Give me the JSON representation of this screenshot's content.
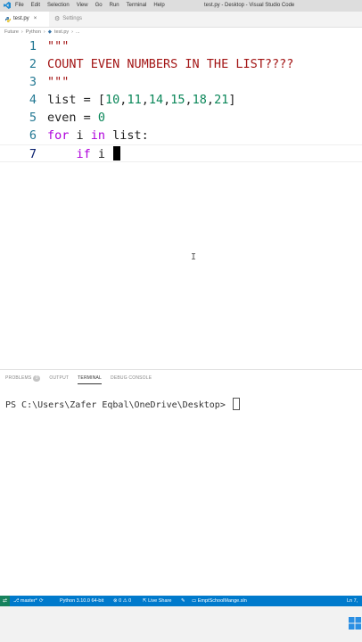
{
  "titlebar": {
    "menu": [
      "File",
      "Edit",
      "Selection",
      "View",
      "Go",
      "Run",
      "Terminal",
      "Help"
    ],
    "window_title": "test.py - Desktop - Visual Studio Code"
  },
  "tabs": [
    {
      "label": "test.py",
      "icon": "python-file-icon",
      "active": true
    },
    {
      "label": "Settings",
      "icon": "gear-icon",
      "active": false
    }
  ],
  "breadcrumb": [
    "Future",
    "Python",
    "test.py",
    "..."
  ],
  "editor": {
    "lines": [
      {
        "number": "1",
        "text": "\"\"\""
      },
      {
        "number": "2",
        "text": "COUNT EVEN NUMBERS IN THE LIST????"
      },
      {
        "number": "3",
        "text": "\"\"\""
      },
      {
        "number": "4",
        "tokens": [
          "list = [",
          "10",
          ",",
          "11",
          ",",
          "14",
          ",",
          "15",
          ",",
          "18",
          ",",
          "21",
          "]"
        ]
      },
      {
        "number": "5",
        "tokens": [
          "even = ",
          "0"
        ]
      },
      {
        "number": "6",
        "tokens": [
          "for",
          " i ",
          "in",
          " list:"
        ]
      },
      {
        "number": "7",
        "tokens": [
          "    ",
          "if",
          " i "
        ]
      }
    ],
    "colors": {
      "string": "#a31515",
      "keyword": "#af00db",
      "number": "#098658",
      "line_number": "#237893"
    }
  },
  "panel": {
    "tabs": [
      "PROBLEMS",
      "OUTPUT",
      "TERMINAL",
      "DEBUG CONSOLE"
    ],
    "problems_count": "0",
    "active_tab": "TERMINAL",
    "terminal_prompt": "PS C:\\Users\\Zafer Eqbal\\OneDrive\\Desktop> "
  },
  "statusbar": {
    "branch": "master*",
    "python": "Python 3.10.0 64-bit",
    "problems": "⊗ 0 ⚠ 0",
    "live_share": "Live Share",
    "solution": "EmptSchoolMange.sln",
    "position": "Ln 7,",
    "color": "#007acc"
  }
}
